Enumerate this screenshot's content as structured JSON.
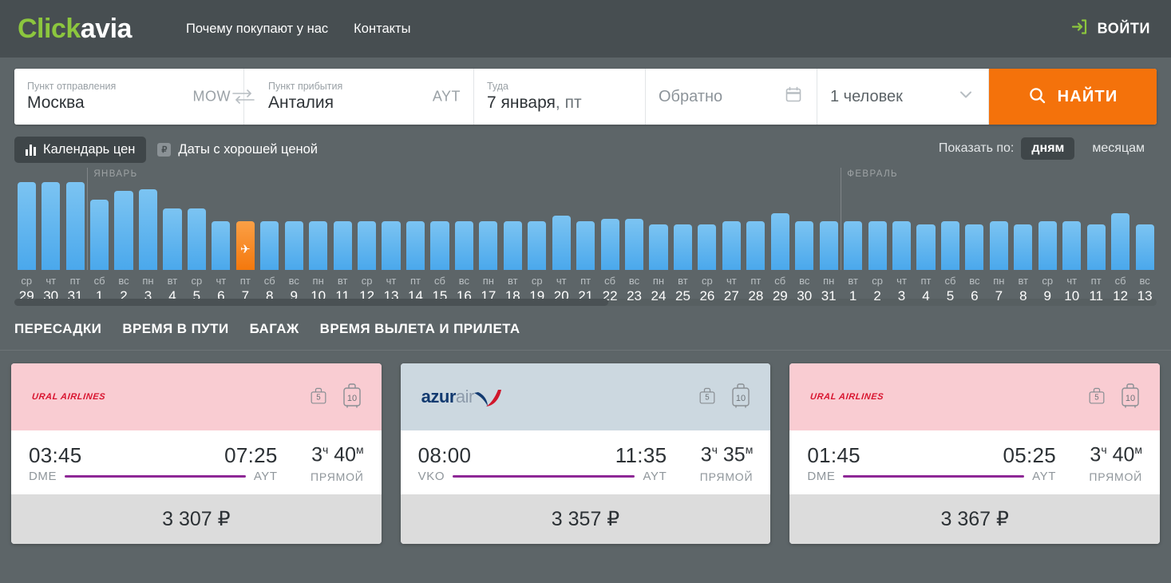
{
  "header": {
    "logo_first": "Click",
    "logo_second": "avia",
    "nav": [
      {
        "label": "Почему покупают у нас"
      },
      {
        "label": "Контакты"
      }
    ],
    "login_label": "ВОЙТИ",
    "login_icon": "login-arrow-icon"
  },
  "search": {
    "from": {
      "label": "Пункт отправления",
      "value": "Москва",
      "code": "MOW"
    },
    "to": {
      "label": "Пункт прибытия",
      "value": "Анталия",
      "code": "AYT"
    },
    "depart": {
      "label": "Туда",
      "value_day": "7 января",
      "value_weekday": ", пт"
    },
    "return": {
      "placeholder": "Обратно",
      "icon": "calendar-icon"
    },
    "passengers": {
      "value": "1 человек",
      "icon": "chevron-down-icon"
    },
    "submit": {
      "label": "НАЙТИ",
      "icon": "search-icon",
      "color": "#f4720b"
    },
    "swap_icon": "swap-arrows-icon"
  },
  "calendar_toolbar": {
    "tab_price_calendar": "Календарь цен",
    "tab_price_calendar_icon": "bar-chart-icon",
    "tab_good_price": "Даты с хорошей ценой",
    "tab_good_price_icon": "ruble-badge-icon",
    "show_by_label": "Показать по:",
    "seg_days": "дням",
    "seg_months": "месяцам"
  },
  "chart_data": {
    "type": "bar",
    "title": "Календарь цен",
    "xlabel": "",
    "ylabel": "",
    "grid": false,
    "legend": null,
    "selected_index": 9,
    "colors": {
      "bar": "#4aa8ec",
      "selected": "#f4780d"
    },
    "month_dividers": [
      {
        "label": "ЯНВАРЬ",
        "before_index": 3
      },
      {
        "label": "ФЕВРАЛЬ",
        "before_index": 34
      }
    ],
    "categories": [
      "ср 29",
      "чт 30",
      "пт 31",
      "сб 1",
      "вс 2",
      "пн 3",
      "вт 4",
      "ср 5",
      "чт 6",
      "пт 7",
      "сб 8",
      "вс 9",
      "пн 10",
      "вт 11",
      "ср 12",
      "чт 13",
      "пт 14",
      "сб 15",
      "вс 16",
      "пн 17",
      "вт 18",
      "ср 19",
      "чт 20",
      "пт 21",
      "сб 22",
      "вс 23",
      "пн 24",
      "вт 25",
      "ср 26",
      "чт 27",
      "пт 28",
      "сб 29",
      "вс 30",
      "пн 31",
      "вт 1",
      "ср 2",
      "чт 3",
      "пт 4",
      "сб 5",
      "вс 6",
      "пн 7",
      "вт 8",
      "ср 9",
      "чт 10",
      "пт 11",
      "сб 12",
      "вс 13"
    ],
    "days": [
      {
        "weekday": "ср",
        "number": "29",
        "value": 96
      },
      {
        "weekday": "чт",
        "number": "30",
        "value": 96
      },
      {
        "weekday": "пт",
        "number": "31",
        "value": 96
      },
      {
        "weekday": "сб",
        "number": "1",
        "value": 77
      },
      {
        "weekday": "вс",
        "number": "2",
        "value": 86
      },
      {
        "weekday": "пн",
        "number": "3",
        "value": 88
      },
      {
        "weekday": "вт",
        "number": "4",
        "value": 67
      },
      {
        "weekday": "ср",
        "number": "5",
        "value": 67
      },
      {
        "weekday": "чт",
        "number": "6",
        "value": 53
      },
      {
        "weekday": "пт",
        "number": "7",
        "value": 53
      },
      {
        "weekday": "сб",
        "number": "8",
        "value": 53
      },
      {
        "weekday": "вс",
        "number": "9",
        "value": 53
      },
      {
        "weekday": "пн",
        "number": "10",
        "value": 53
      },
      {
        "weekday": "вт",
        "number": "11",
        "value": 53
      },
      {
        "weekday": "ср",
        "number": "12",
        "value": 53
      },
      {
        "weekday": "чт",
        "number": "13",
        "value": 53
      },
      {
        "weekday": "пт",
        "number": "14",
        "value": 53
      },
      {
        "weekday": "сб",
        "number": "15",
        "value": 53
      },
      {
        "weekday": "вс",
        "number": "16",
        "value": 53
      },
      {
        "weekday": "пн",
        "number": "17",
        "value": 53
      },
      {
        "weekday": "вт",
        "number": "18",
        "value": 53
      },
      {
        "weekday": "ср",
        "number": "19",
        "value": 53
      },
      {
        "weekday": "чт",
        "number": "20",
        "value": 59
      },
      {
        "weekday": "пт",
        "number": "21",
        "value": 53
      },
      {
        "weekday": "сб",
        "number": "22",
        "value": 56
      },
      {
        "weekday": "вс",
        "number": "23",
        "value": 56
      },
      {
        "weekday": "пн",
        "number": "24",
        "value": 50
      },
      {
        "weekday": "вт",
        "number": "25",
        "value": 50
      },
      {
        "weekday": "ср",
        "number": "26",
        "value": 50
      },
      {
        "weekday": "чт",
        "number": "27",
        "value": 53
      },
      {
        "weekday": "пт",
        "number": "28",
        "value": 53
      },
      {
        "weekday": "сб",
        "number": "29",
        "value": 62
      },
      {
        "weekday": "вс",
        "number": "30",
        "value": 53
      },
      {
        "weekday": "пн",
        "number": "31",
        "value": 53
      },
      {
        "weekday": "вт",
        "number": "1",
        "value": 53
      },
      {
        "weekday": "ср",
        "number": "2",
        "value": 53
      },
      {
        "weekday": "чт",
        "number": "3",
        "value": 53
      },
      {
        "weekday": "пт",
        "number": "4",
        "value": 50
      },
      {
        "weekday": "сб",
        "number": "5",
        "value": 53
      },
      {
        "weekday": "вс",
        "number": "6",
        "value": 50
      },
      {
        "weekday": "пн",
        "number": "7",
        "value": 53
      },
      {
        "weekday": "вт",
        "number": "8",
        "value": 50
      },
      {
        "weekday": "ср",
        "number": "9",
        "value": 53
      },
      {
        "weekday": "чт",
        "number": "10",
        "value": 53
      },
      {
        "weekday": "пт",
        "number": "11",
        "value": 50
      },
      {
        "weekday": "сб",
        "number": "12",
        "value": 62
      },
      {
        "weekday": "вс",
        "number": "13",
        "value": 50
      }
    ]
  },
  "filters": [
    {
      "label": "ПЕРЕСАДКИ"
    },
    {
      "label": "ВРЕМЯ В ПУТИ"
    },
    {
      "label": "БАГАЖ"
    },
    {
      "label": "ВРЕМЯ ВЫЛЕТА И ПРИЛЕТА"
    }
  ],
  "flights": [
    {
      "airline": "URAL AIRLINES",
      "airline_style": "ural",
      "header_color": "#f9ccd2",
      "bag_cabin": "5",
      "bag_checked": "10",
      "depart_time": "03:45",
      "arrive_time": "07:25",
      "depart_code": "DME",
      "arrive_code": "AYT",
      "duration_hours": "3",
      "duration_hours_unit": "ч",
      "duration_minutes": "40",
      "duration_minutes_unit": "м",
      "stops": "ПРЯМОЙ",
      "price": "3 307 ₽"
    },
    {
      "airline": "azurair",
      "airline_style": "azur",
      "airline_part1": "azur",
      "airline_part2": "air",
      "header_color": "#ccd8e0",
      "bag_cabin": "5",
      "bag_checked": "10",
      "depart_time": "08:00",
      "arrive_time": "11:35",
      "depart_code": "VKO",
      "arrive_code": "AYT",
      "duration_hours": "3",
      "duration_hours_unit": "ч",
      "duration_minutes": "35",
      "duration_minutes_unit": "м",
      "stops": "ПРЯМОЙ",
      "price": "3 357 ₽"
    },
    {
      "airline": "URAL AIRLINES",
      "airline_style": "ural",
      "header_color": "#f9ccd2",
      "bag_cabin": "5",
      "bag_checked": "10",
      "depart_time": "01:45",
      "arrive_time": "05:25",
      "depart_code": "DME",
      "arrive_code": "AYT",
      "duration_hours": "3",
      "duration_hours_unit": "ч",
      "duration_minutes": "40",
      "duration_minutes_unit": "м",
      "stops": "ПРЯМОЙ",
      "price": "3 367 ₽"
    }
  ]
}
